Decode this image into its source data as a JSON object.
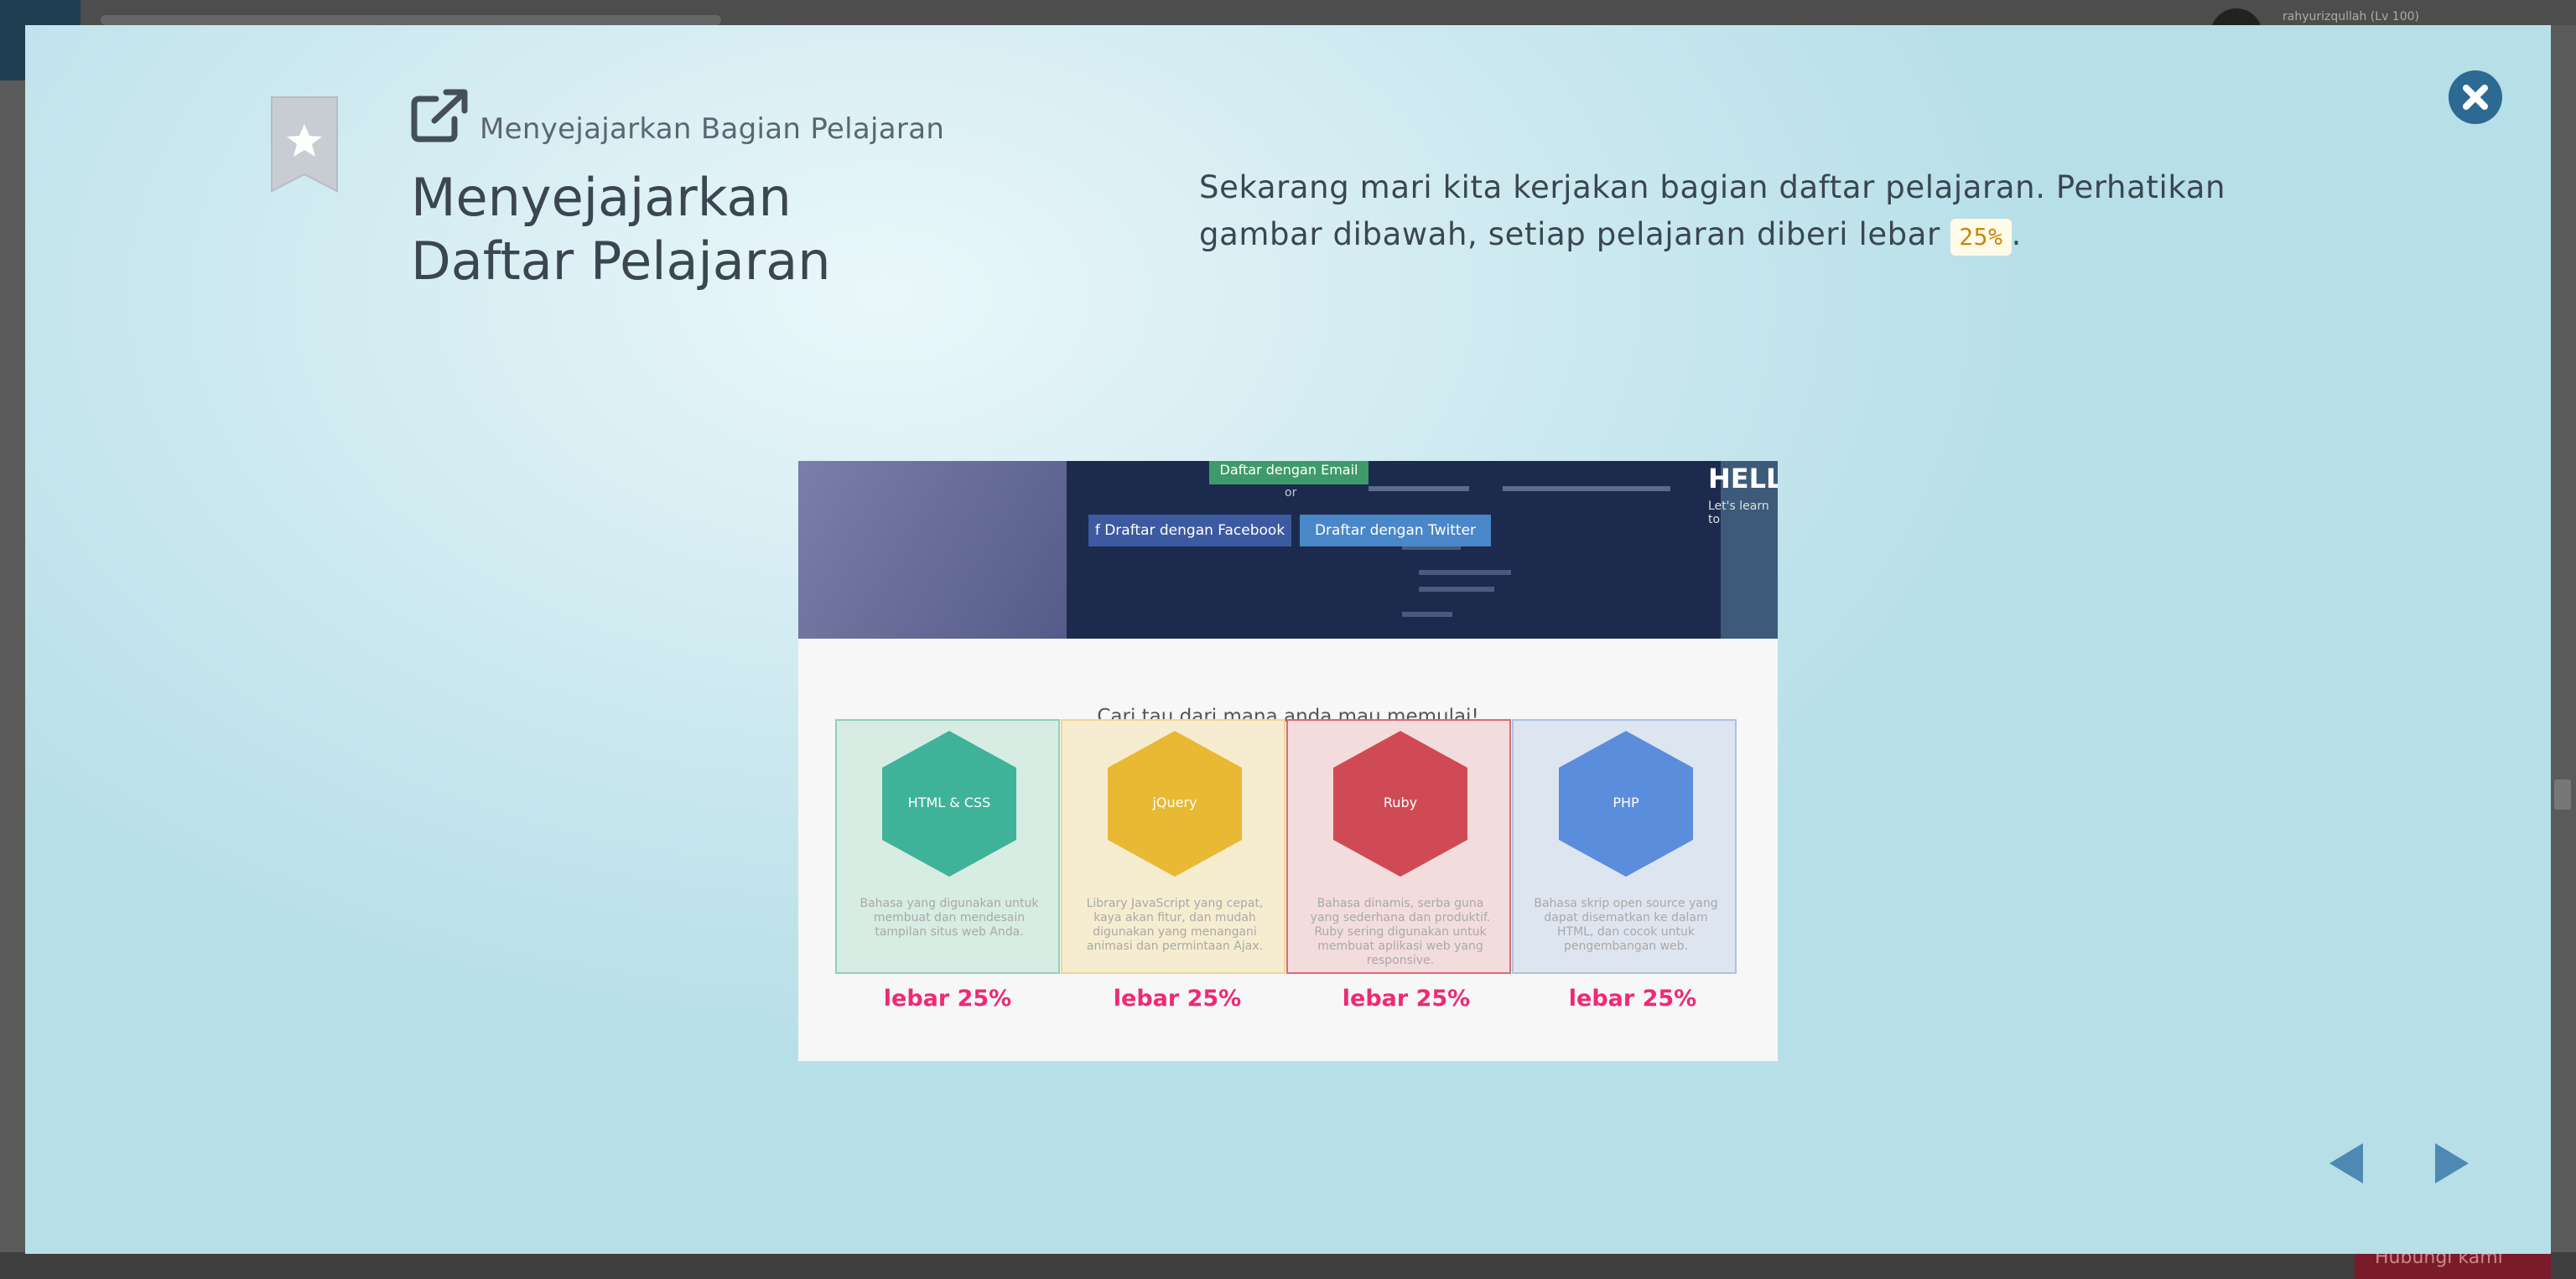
{
  "background_app": {
    "username": "rahyurizqullah (Lv 100)",
    "bottom_button": "Hubungi kami"
  },
  "modal": {
    "breadcrumb": "Menyejajarkan Bagian Pelajaran",
    "title_line1": "Menyejajarkan",
    "title_line2": "Daftar Pelajaran",
    "description_before": "Sekarang mari kita kerjakan bagian daftar pelajaran. Perhatikan gambar dibawah, setiap pelajaran diberi lebar ",
    "description_code": "25%",
    "description_after": ".",
    "icons": {
      "bookmark": "bookmark-star-icon",
      "header": "external-link-icon",
      "close": "close-icon",
      "prev": "arrow-left-icon",
      "next": "arrow-right-icon"
    }
  },
  "figure": {
    "hero": {
      "email_button": "Daftar dengan Email",
      "or_text": "or",
      "facebook_button": "f  Draftar dengan Facebook",
      "twitter_button": "Draftar dengan Twitter",
      "hello_text": "HELL",
      "hello_sub": "Let's learn to"
    },
    "section_title": "Cari tau dari mana anda mau memulai!",
    "cards": [
      {
        "name": "HTML & CSS",
        "desc": "Bahasa yang digunakan untuk membuat dan mendesain tampilan situs web Anda.",
        "color": "#3fb39a",
        "bg": "#d7ece2",
        "border": "#8fd0bd",
        "width_label": "lebar 25%"
      },
      {
        "name": "jQuery",
        "desc": "Library JavaScript yang cepat, kaya akan fitur, dan mudah digunakan yang menangani animasi dan permintaan Ajax.",
        "color": "#e9b933",
        "bg": "#f6ecd0",
        "border": "#efd597",
        "width_label": "lebar 25%"
      },
      {
        "name": "Ruby",
        "desc": "Bahasa dinamis, serba guna yang sederhana dan produktif. Ruby sering digunakan untuk membuat aplikasi web yang responsive.",
        "color": "#d04a55",
        "bg": "#f3dcdc",
        "border": "#d96a74",
        "width_label": "lebar 25%"
      },
      {
        "name": "PHP",
        "desc": "Bahasa skrip open source yang dapat disematkan ke dalam HTML, dan cocok untuk pengembangan web.",
        "color": "#5a8ddc",
        "bg": "#dde5f0",
        "border": "#aec2e6",
        "width_label": "lebar 25%"
      }
    ]
  },
  "colors": {
    "accent": "#2c6a94",
    "nav_arrow": "#4e89b3",
    "highlight": "#ee2a74"
  }
}
